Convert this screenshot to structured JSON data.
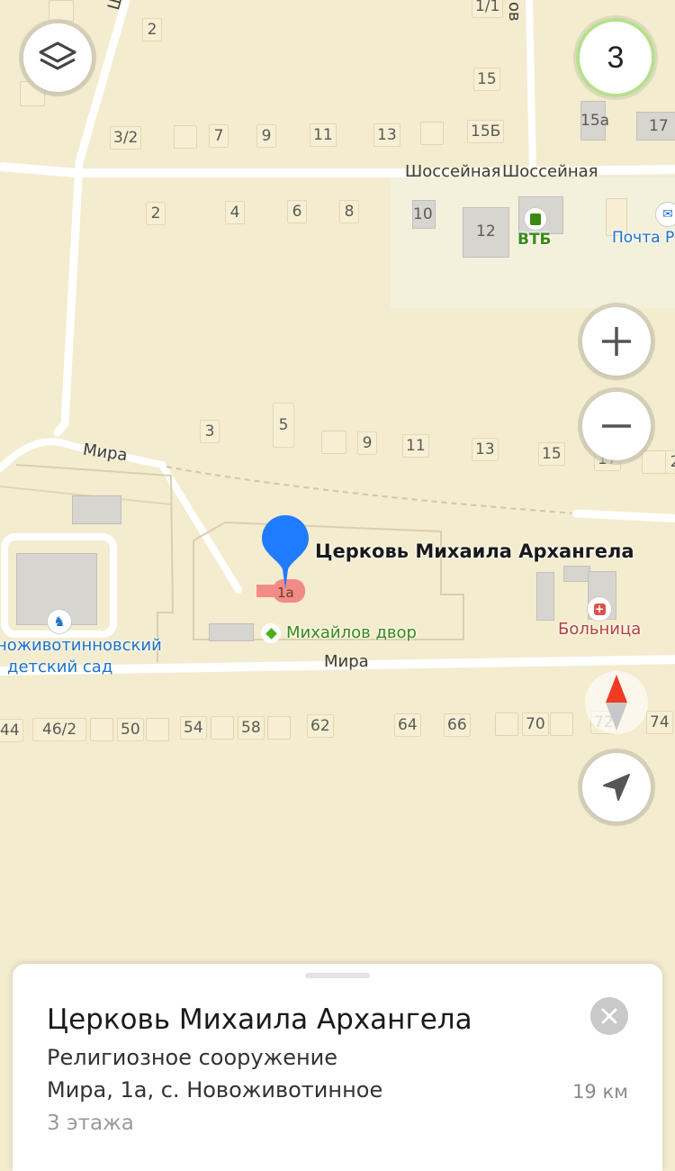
{
  "map": {
    "streets": {
      "shkolnaya_top": "Шк",
      "top_right_fragment": "ов",
      "shosseinaya_1": "Шоссейная",
      "shosseinaya_2": "Шоссейная",
      "mira_upper": "Мира",
      "mira_lower": "Мира"
    },
    "house_numbers": {
      "n1_1": "1/1",
      "n2a": "2",
      "n15": "15",
      "n15a": "15а",
      "n17": "17",
      "n3_2": "3/2",
      "n7": "7",
      "n9a": "9",
      "n11a": "11",
      "n13a": "13",
      "n15b": "15Б",
      "n2b": "2",
      "n4": "4",
      "n6": "6",
      "n8": "8",
      "n10": "10",
      "n12": "12",
      "n3": "3",
      "n5": "5",
      "n9b": "9",
      "n11b": "11",
      "n13b": "13",
      "n15c": "15",
      "n17b": "17",
      "n2c": "2",
      "n1a": "1а",
      "n44": "44",
      "n46_2": "46/2",
      "n50": "50",
      "n54": "54",
      "n58": "58",
      "n62": "62",
      "n64": "64",
      "n66": "66",
      "n70": "70",
      "n72": "72",
      "n74": "74"
    },
    "pois": {
      "vtb": "ВТБ",
      "post": "Почта Р",
      "kindergarten_line1": "ноживотинновский",
      "kindergarten_line2": "детский сад",
      "mikhailov_dvor": "Михайлов двор",
      "hospital": "Больница",
      "selected_title": "Церковь Михаила Архангела"
    },
    "colors": {
      "pin": "#1f7bff",
      "vtb": "#3a8a16",
      "post": "#1c72c9",
      "hospital": "#b3413b",
      "poi_green": "#3a8a16",
      "church_building": "#f28b86"
    }
  },
  "controls": {
    "layers_icon": "layers-icon",
    "traffic_level": "3",
    "zoom_in_icon": "plus-icon",
    "zoom_out_icon": "minus-icon",
    "compass_icon": "compass-icon",
    "locate_icon": "navigation-arrow-icon"
  },
  "card": {
    "title": "Церковь Михаила Архангела",
    "category": "Религиозное сооружение",
    "address": "Мира, 1а, с. Новоживотинное",
    "distance": "19 км",
    "floors": "3 этажа",
    "close_icon": "close-icon"
  }
}
